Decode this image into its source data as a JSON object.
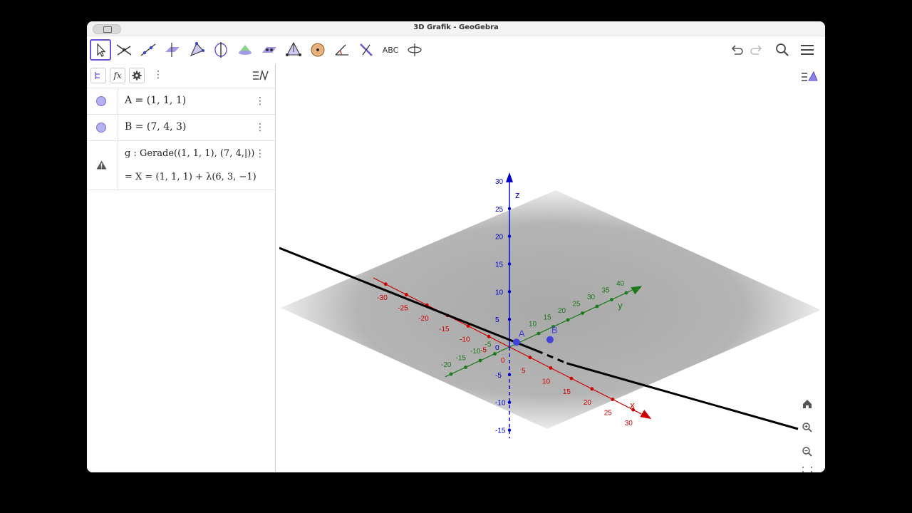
{
  "window": {
    "title": "3D Grafik - GeoGebra"
  },
  "toolbar": {
    "tools": [
      "move",
      "intersect",
      "line",
      "plane",
      "pyramid",
      "rotate",
      "cone",
      "reflect",
      "tetrahedron",
      "sphere",
      "angle",
      "perpendicular",
      "text",
      "view-rotate"
    ],
    "text_tool_label": "ABC"
  },
  "algebra": {
    "rows": [
      {
        "name": "point-a",
        "text": "A = (1, 1, 1)"
      },
      {
        "name": "point-b",
        "text": "B = (7, 4, 3)"
      }
    ],
    "line_def": "g : Gerade((1, 1, 1), (7, 4,|))",
    "line_result": "=  X = (1, 1, 1) + λ(6, 3, −1)"
  },
  "graphics": {
    "axis_labels": {
      "x": "x",
      "y": "y",
      "z": "z"
    },
    "point_labels": {
      "a": "A",
      "b": "B"
    },
    "x_ticks": [
      "-30",
      "-25",
      "-20",
      "-15",
      "-10",
      "-5",
      "0",
      "5",
      "10",
      "15",
      "20",
      "25",
      "30"
    ],
    "y_ticks": [
      "-20",
      "-15",
      "-10",
      "-5",
      "10",
      "15",
      "20",
      "25",
      "30",
      "35",
      "40"
    ],
    "z_ticks": [
      "30",
      "25",
      "20",
      "15",
      "10",
      "5",
      "0",
      "-5",
      "-10",
      "-15"
    ]
  },
  "colors": {
    "accent": "#6557d2",
    "x_axis": "#cc0000",
    "y_axis": "#1a7a1a",
    "z_axis": "#0000cc",
    "point": "#4444dd"
  }
}
